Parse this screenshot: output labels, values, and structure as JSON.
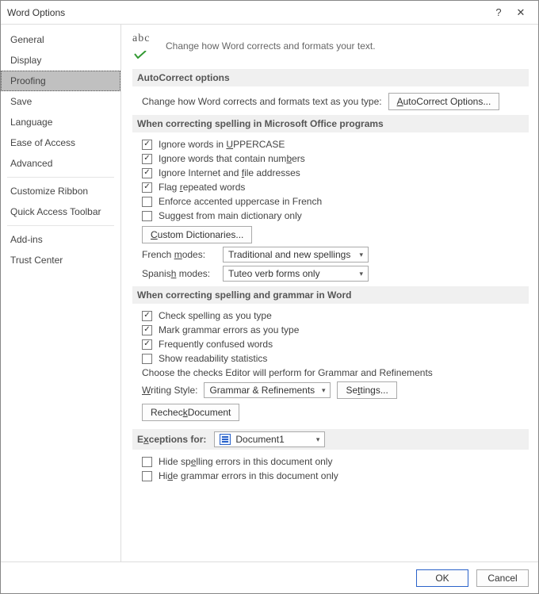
{
  "window": {
    "title": "Word Options"
  },
  "sidebar": [
    "General",
    "Display",
    "Proofing",
    "Save",
    "Language",
    "Ease of Access",
    "Advanced",
    "Customize Ribbon",
    "Quick Access Toolbar",
    "Add-ins",
    "Trust Center"
  ],
  "intro": {
    "icon_abc": "abc",
    "text": "Change how Word corrects and formats your text."
  },
  "autocorrect": {
    "head": "AutoCorrect options",
    "label": "Change how Word corrects and formats text as you type:",
    "button_prefix": "A",
    "button_rest": "utoCorrect Options..."
  },
  "spelling_office": {
    "head": "When correcting spelling in Microsoft Office programs",
    "opts": [
      {
        "checked": true,
        "pre": "Ignore words in ",
        "u": "U",
        "post": "PPERCASE"
      },
      {
        "checked": true,
        "pre": "Ignore words that contain num",
        "u": "b",
        "post": "ers"
      },
      {
        "checked": true,
        "pre": "Ignore Internet and ",
        "u": "f",
        "post": "ile addresses"
      },
      {
        "checked": true,
        "pre": "Flag ",
        "u": "r",
        "post": "epeated words"
      },
      {
        "checked": false,
        "pre": "Enforce accented uppercase in French",
        "u": "",
        "post": ""
      },
      {
        "checked": false,
        "pre": "Suggest from main dictionary only",
        "u": "",
        "post": ""
      }
    ],
    "custom_dict_u": "C",
    "custom_dict_rest": "ustom Dictionaries...",
    "french_label_pre": "French ",
    "french_label_u": "m",
    "french_label_post": "odes:",
    "french_value": "Traditional and new spellings",
    "spanish_label_pre": "Spanis",
    "spanish_label_u": "h",
    "spanish_label_post": " modes:",
    "spanish_value": "Tuteo verb forms only"
  },
  "spelling_word": {
    "head": "When correcting spelling and grammar in Word",
    "opts": [
      {
        "checked": true,
        "text": "Check spelling as you type"
      },
      {
        "checked": true,
        "text": "Mark grammar errors as you type"
      },
      {
        "checked": true,
        "text": "Frequently confused words"
      },
      {
        "checked": false,
        "text": "Show readability statistics"
      }
    ],
    "choose_label": "Choose the checks Editor will perform for Grammar and Refinements",
    "writing_style_label_u": "W",
    "writing_style_label_rest": "riting Style:",
    "writing_style_value": "Grammar & Refinements",
    "settings_btn_pre": "Se",
    "settings_btn_u": "t",
    "settings_btn_post": "tings...",
    "recheck_pre": "Rechec",
    "recheck_u": "k",
    "recheck_post": " Document"
  },
  "exceptions": {
    "head_pre": "E",
    "head_u": "x",
    "head_post": "ceptions for:",
    "doc_value": "Document1",
    "opts": [
      {
        "checked": false,
        "pre": "Hide sp",
        "u": "e",
        "post": "lling errors in this document only"
      },
      {
        "checked": false,
        "pre": "Hi",
        "u": "d",
        "post": "e grammar errors in this document only"
      }
    ]
  },
  "footer": {
    "ok": "OK",
    "cancel": "Cancel"
  }
}
